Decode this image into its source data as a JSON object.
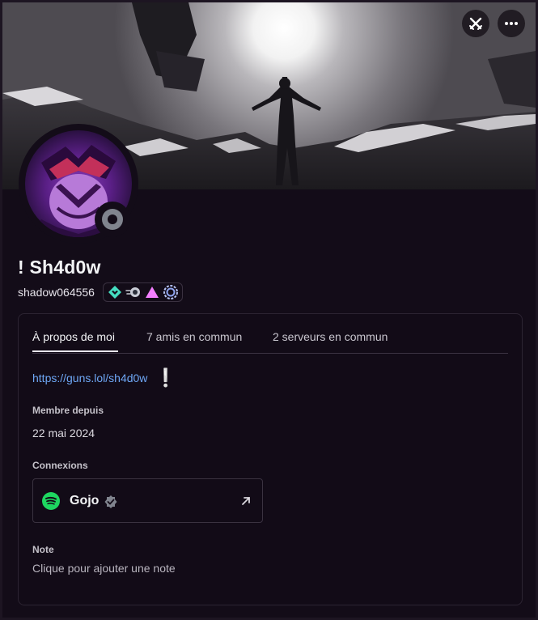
{
  "profile": {
    "display_name": "! Sh4d0w",
    "username": "shadow064556",
    "status": "offline",
    "badges": [
      "hypesquad-balance-badge",
      "boost-badge",
      "quest-badge",
      "nitro-badge"
    ]
  },
  "header": {
    "boost_icon": "boost-swords-icon",
    "more_icon": "more-dots-icon"
  },
  "tabs": [
    {
      "label": "À propos de moi",
      "active": true
    },
    {
      "label": "7 amis en commun",
      "active": false
    },
    {
      "label": "2 serveurs en commun",
      "active": false
    }
  ],
  "about": {
    "bio_link": "https://guns.lol/sh4d0w",
    "bio_emoji": "❕"
  },
  "member_since": {
    "title": "Membre depuis",
    "value": "22 mai 2024"
  },
  "connections": {
    "title": "Connexions",
    "items": [
      {
        "service": "spotify",
        "name": "Gojo",
        "verified": true
      }
    ]
  },
  "note": {
    "title": "Note",
    "placeholder": "Clique pour ajouter une note"
  },
  "colors": {
    "background": "#130c18",
    "link": "#6ea7f5",
    "spotify": "#1ed760",
    "status_offline": "#80848e"
  }
}
